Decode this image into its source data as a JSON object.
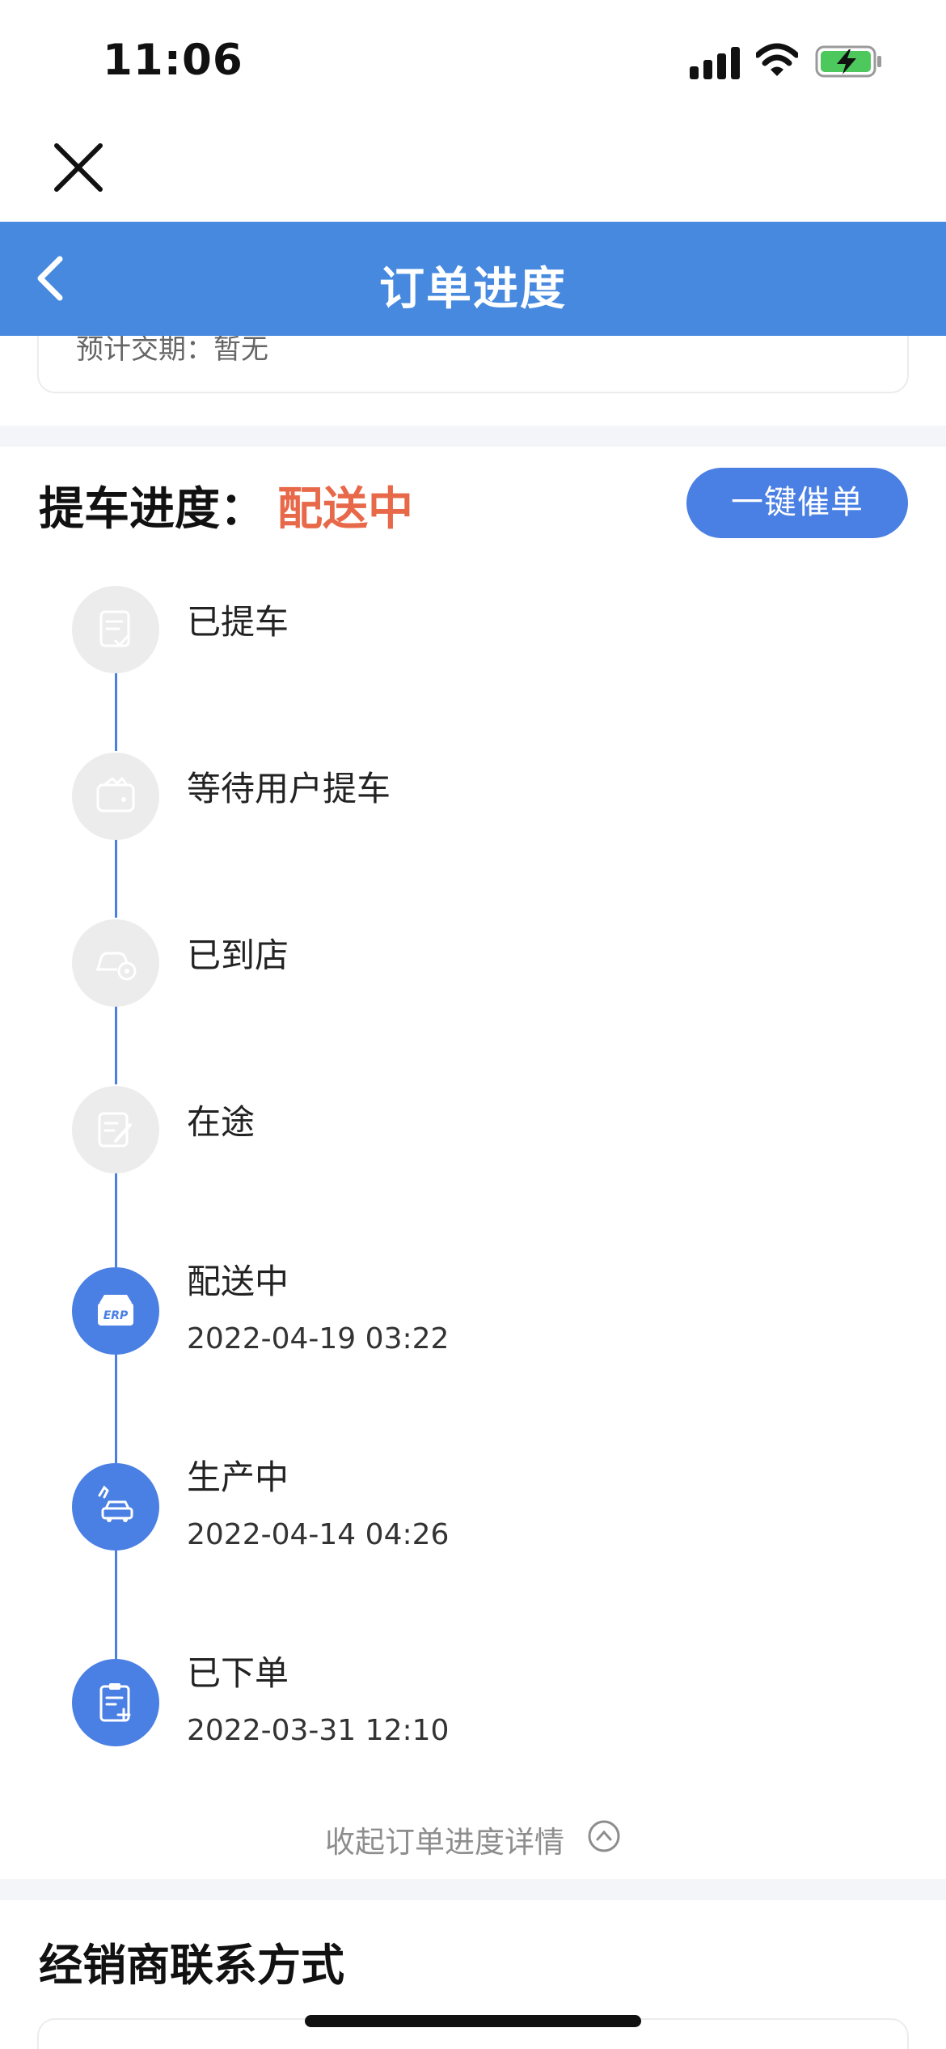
{
  "status_bar": {
    "time": "11:06"
  },
  "header": {
    "title": "订单进度"
  },
  "top_card": {
    "text": "预计交期：暂无"
  },
  "progress": {
    "heading": "提车进度：",
    "status": "配送中",
    "status_color": "#E8694A",
    "urge_button": "一键催单",
    "steps": [
      {
        "label": "已提车",
        "time": "",
        "completed": false,
        "icon": "document-check-icon"
      },
      {
        "label": "等待用户提车",
        "time": "",
        "completed": false,
        "icon": "wallet-icon"
      },
      {
        "label": "已到店",
        "time": "",
        "completed": false,
        "icon": "car-store-icon"
      },
      {
        "label": "在途",
        "time": "",
        "completed": false,
        "icon": "edit-note-icon"
      },
      {
        "label": "配送中",
        "time": "2022-04-19 03:22",
        "completed": true,
        "icon": "erp-truck-icon"
      },
      {
        "label": "生产中",
        "time": "2022-04-14 04:26",
        "completed": true,
        "icon": "car-assembly-icon"
      },
      {
        "label": "已下单",
        "time": "2022-03-31 12:10",
        "completed": true,
        "icon": "clipboard-add-icon"
      }
    ],
    "collapse_text": "收起订单进度详情"
  },
  "dealer": {
    "title": "经销商联系方式"
  },
  "colors": {
    "accent": "#4A7FE3",
    "header": "#4689DF",
    "inactive": "#ECECEC"
  }
}
